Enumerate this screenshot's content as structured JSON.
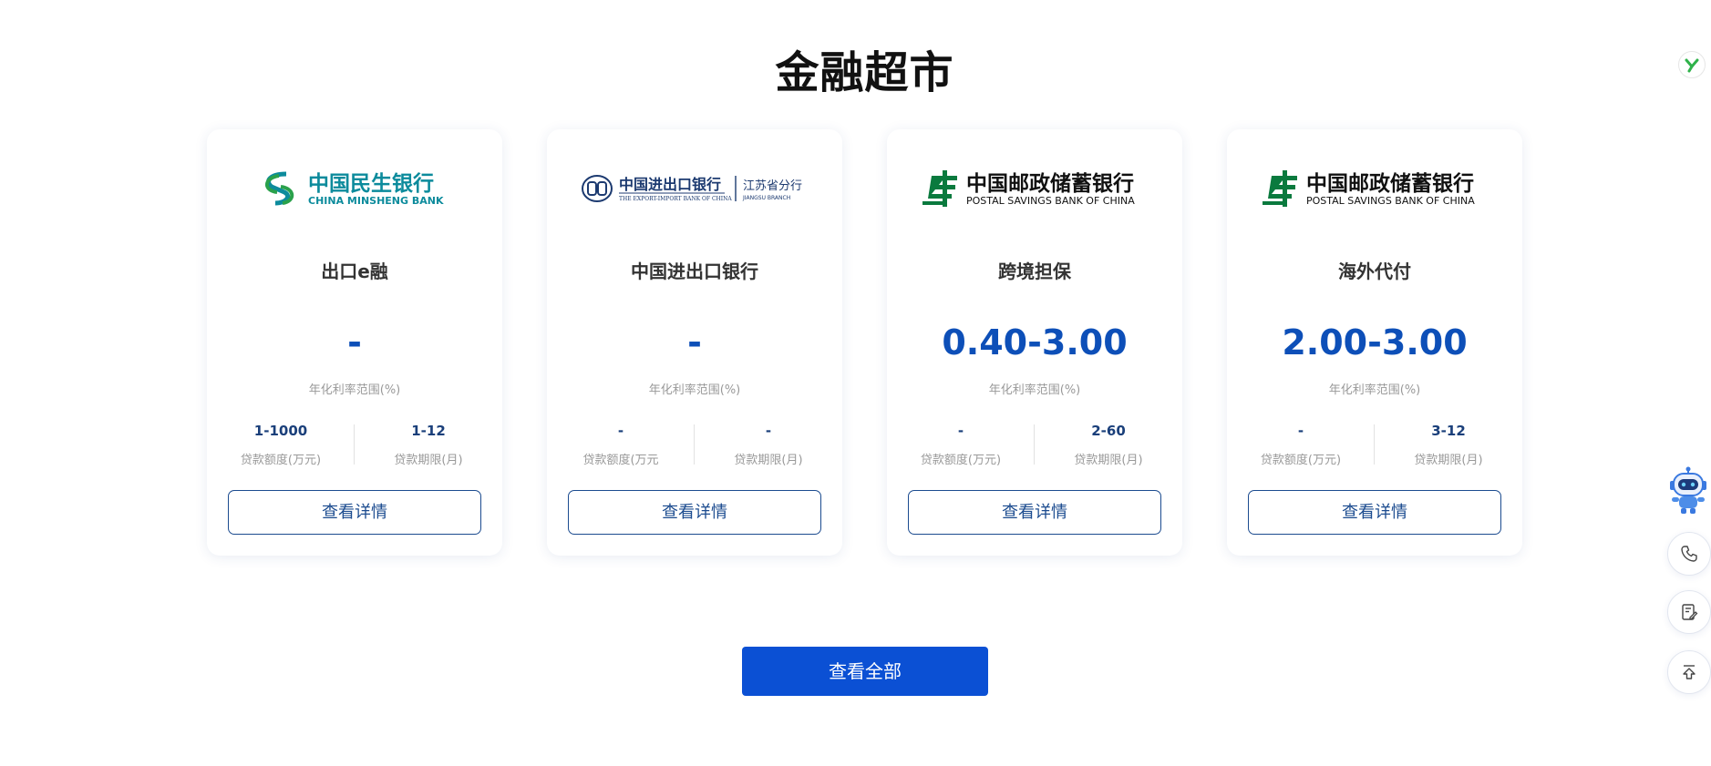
{
  "page": {
    "title": "金融超市"
  },
  "cards": [
    {
      "logo": {
        "bank_cn": "中国民生银行",
        "bank_en": "CHINA MINSHENG BANK",
        "brand_color": "#0c8b9c"
      },
      "product_name": "出口e融",
      "rate": "-",
      "rate_label": "年化利率范围(%)",
      "amount": {
        "value": "1-1000",
        "label": "贷款额度(万元)"
      },
      "term": {
        "value": "1-12",
        "label": "贷款期限(月)"
      },
      "detail_button": "查看详情"
    },
    {
      "logo": {
        "bank_cn": "中国进出口银行",
        "bank_en": "THE EXPORT-IMPORT BANK OF CHINA",
        "branch_cn": "江苏省分行",
        "branch_en": "JIANGSU BRANCH",
        "brand_color": "#1c3a70"
      },
      "product_name": "中国进出口银行",
      "rate": "-",
      "rate_label": "年化利率范围(%)",
      "amount": {
        "value": "-",
        "label": "贷款额度(万元"
      },
      "term": {
        "value": "-",
        "label": "贷款期限(月)"
      },
      "detail_button": "查看详情"
    },
    {
      "logo": {
        "bank_cn": "中国邮政储蓄银行",
        "bank_en": "POSTAL SAVINGS BANK OF CHINA",
        "brand_color": "#0a7a3e"
      },
      "product_name": "跨境担保",
      "rate": "0.40-3.00",
      "rate_label": "年化利率范围(%)",
      "amount": {
        "value": "-",
        "label": "贷款额度(万元)"
      },
      "term": {
        "value": "2-60",
        "label": "贷款期限(月)"
      },
      "detail_button": "查看详情"
    },
    {
      "logo": {
        "bank_cn": "中国邮政储蓄银行",
        "bank_en": "POSTAL SAVINGS BANK OF CHINA",
        "brand_color": "#0a7a3e"
      },
      "product_name": "海外代付",
      "rate": "2.00-3.00",
      "rate_label": "年化利率范围(%)",
      "amount": {
        "value": "-",
        "label": "贷款额度(万元)"
      },
      "term": {
        "value": "3-12",
        "label": "贷款期限(月)"
      },
      "detail_button": "查看详情"
    }
  ],
  "view_all_button": "查看全部",
  "side_tools": {
    "icons": [
      "y-badge-icon",
      "robot-assistant-icon",
      "phone-icon",
      "note-edit-icon",
      "back-to-top-icon"
    ]
  },
  "colors": {
    "accent": "#0b50d4",
    "rate": "#0d4fb8",
    "button_border": "#1b4b8f"
  }
}
